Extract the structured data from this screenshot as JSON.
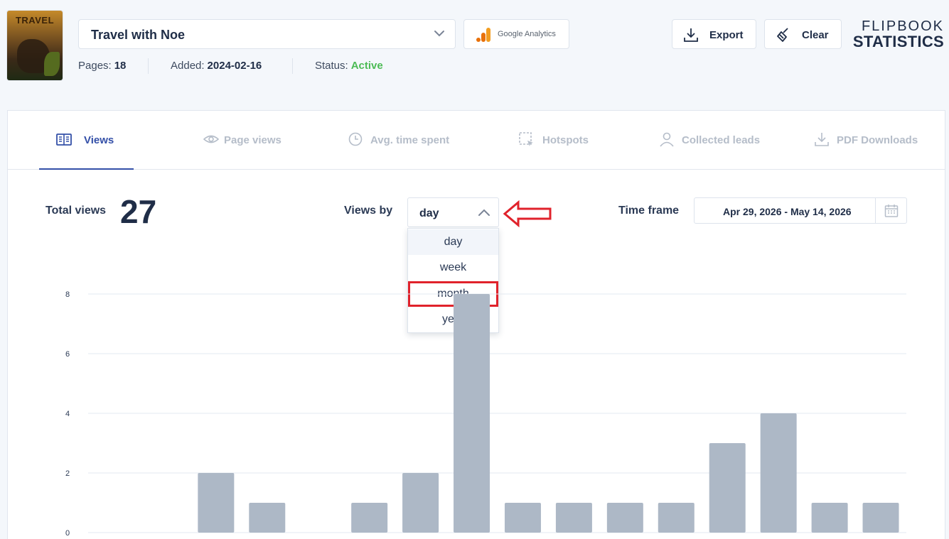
{
  "book": {
    "cover_title": "TRAVEL",
    "title": "Travel with Noe",
    "pages_label": "Pages:",
    "pages": "18",
    "added_label": "Added:",
    "added": "2024-02-16",
    "status_label": "Status:",
    "status": "Active"
  },
  "header": {
    "ga_label": "Google Analytics",
    "export_label": "Export",
    "clear_label": "Clear",
    "brand_line1": "FLIPBOOK",
    "brand_line2": "STATISTICS"
  },
  "tabs": [
    {
      "label": "Views",
      "active": true
    },
    {
      "label": "Page views",
      "active": false
    },
    {
      "label": "Avg. time spent",
      "active": false
    },
    {
      "label": "Hotspots",
      "active": false
    },
    {
      "label": "Collected leads",
      "active": false
    },
    {
      "label": "PDF Downloads",
      "active": false
    }
  ],
  "stats": {
    "total_label": "Total views",
    "total_value": "27",
    "views_by_label": "Views by",
    "views_by_value": "day",
    "views_by_options": [
      "day",
      "week",
      "month",
      "year"
    ],
    "time_frame_label": "Time frame",
    "time_frame_value": "Apr 29, 2026 - May 14, 2026"
  },
  "colors": {
    "accent": "#3450a8",
    "status_active": "#4cbb55",
    "bar": "#adb8c6",
    "highlight": "#e0222b"
  },
  "chart_data": {
    "type": "bar",
    "categories": [
      "",
      "",
      "",
      "",
      "",
      "",
      "",
      "",
      "",
      "",
      "",
      "",
      "",
      "",
      "",
      ""
    ],
    "values": [
      0,
      0,
      2,
      1,
      0,
      1,
      2,
      8,
      1,
      1,
      1,
      1,
      3,
      4,
      1,
      1
    ],
    "yticks": [
      "0",
      "2",
      "4",
      "6",
      "8"
    ],
    "ylim": [
      0,
      8
    ],
    "grid": true
  }
}
